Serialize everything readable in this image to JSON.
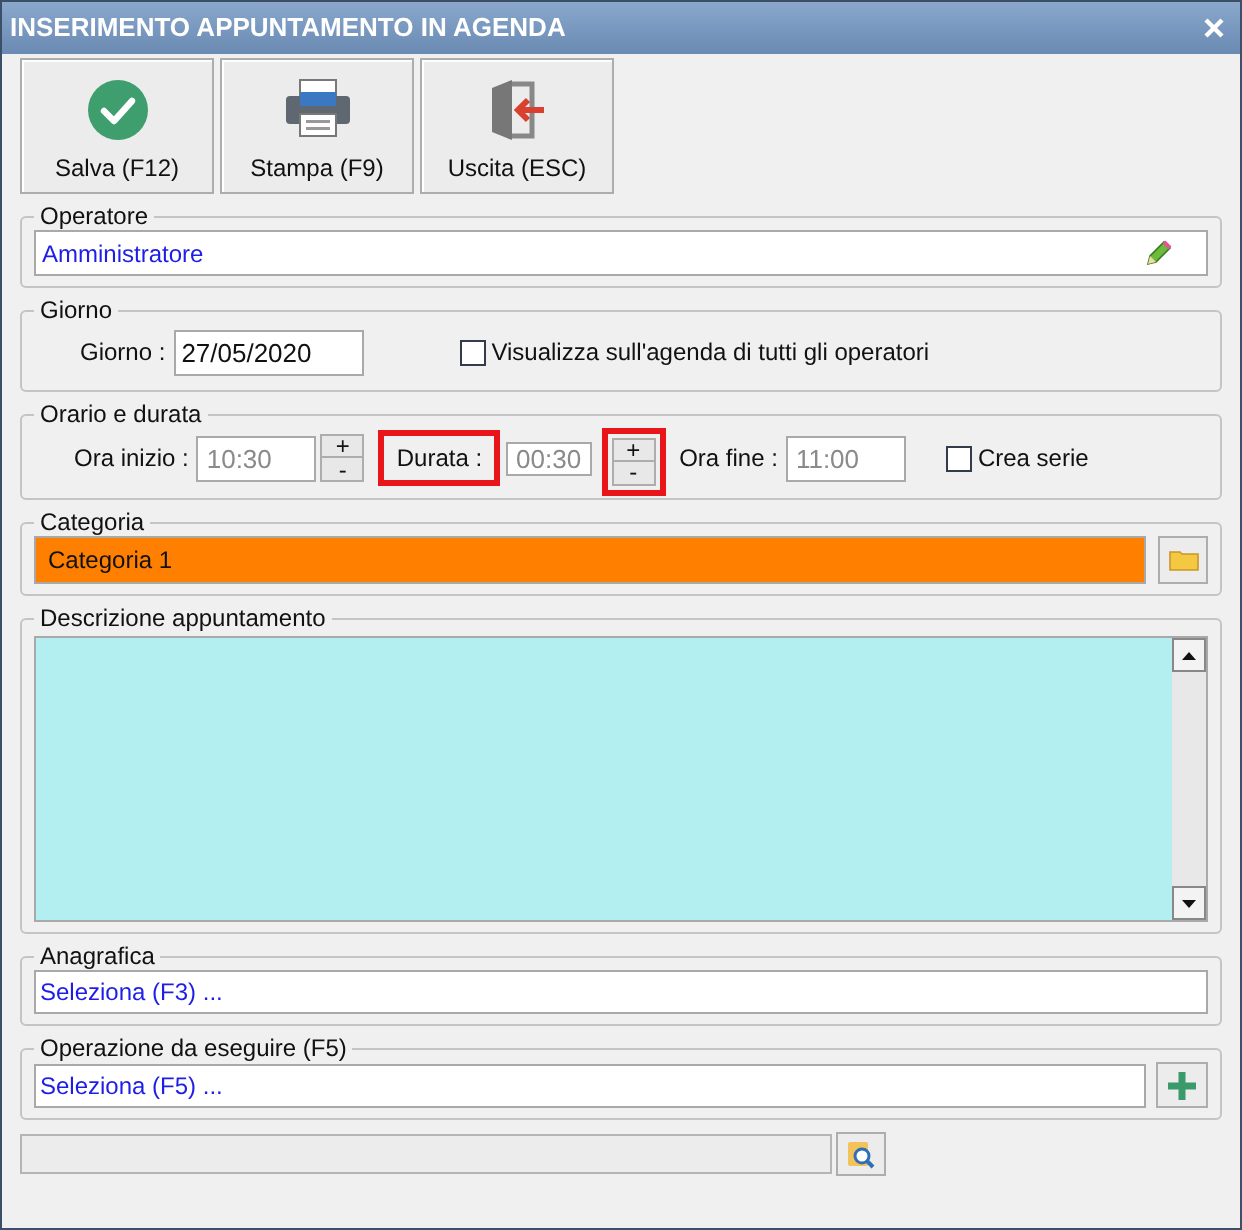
{
  "window": {
    "title": "INSERIMENTO APPUNTAMENTO IN AGENDA"
  },
  "toolbar": [
    {
      "label": "Salva (F12)",
      "kind": "save"
    },
    {
      "label": "Stampa (F9)",
      "kind": "print"
    },
    {
      "label": "Uscita (ESC)",
      "kind": "exit"
    }
  ],
  "operatore": {
    "legend": "Operatore",
    "value": "Amministratore"
  },
  "giorno": {
    "legend": "Giorno",
    "label": "Giorno :",
    "value": "27/05/2020",
    "checkbox": {
      "label": "Visualizza sull'agenda di tutti gli operatori",
      "checked": false
    }
  },
  "orario": {
    "legend": "Orario e durata",
    "start": {
      "label": "Ora inizio :",
      "value": "10:30",
      "disabled": true,
      "plus": "+",
      "minus": "-"
    },
    "duration": {
      "label": "Durata :",
      "value": "00:30",
      "disabled": true,
      "plus": "+",
      "minus": "-",
      "label_highlighted": true,
      "stepper_highlighted": true
    },
    "end": {
      "label": "Ora fine :",
      "value": "11:00",
      "disabled": true
    },
    "series": {
      "label": "Crea serie",
      "checked": false
    }
  },
  "categoria": {
    "legend": "Categoria",
    "value": "Categoria 1",
    "color": "#ff8000"
  },
  "descrizione": {
    "legend": "Descrizione appuntamento"
  },
  "anagrafica": {
    "legend": "Anagrafica",
    "value": "Seleziona (F3) ..."
  },
  "operazione": {
    "legend": "Operazione da eseguire (F5)",
    "value": "Seleziona (F5) ..."
  }
}
